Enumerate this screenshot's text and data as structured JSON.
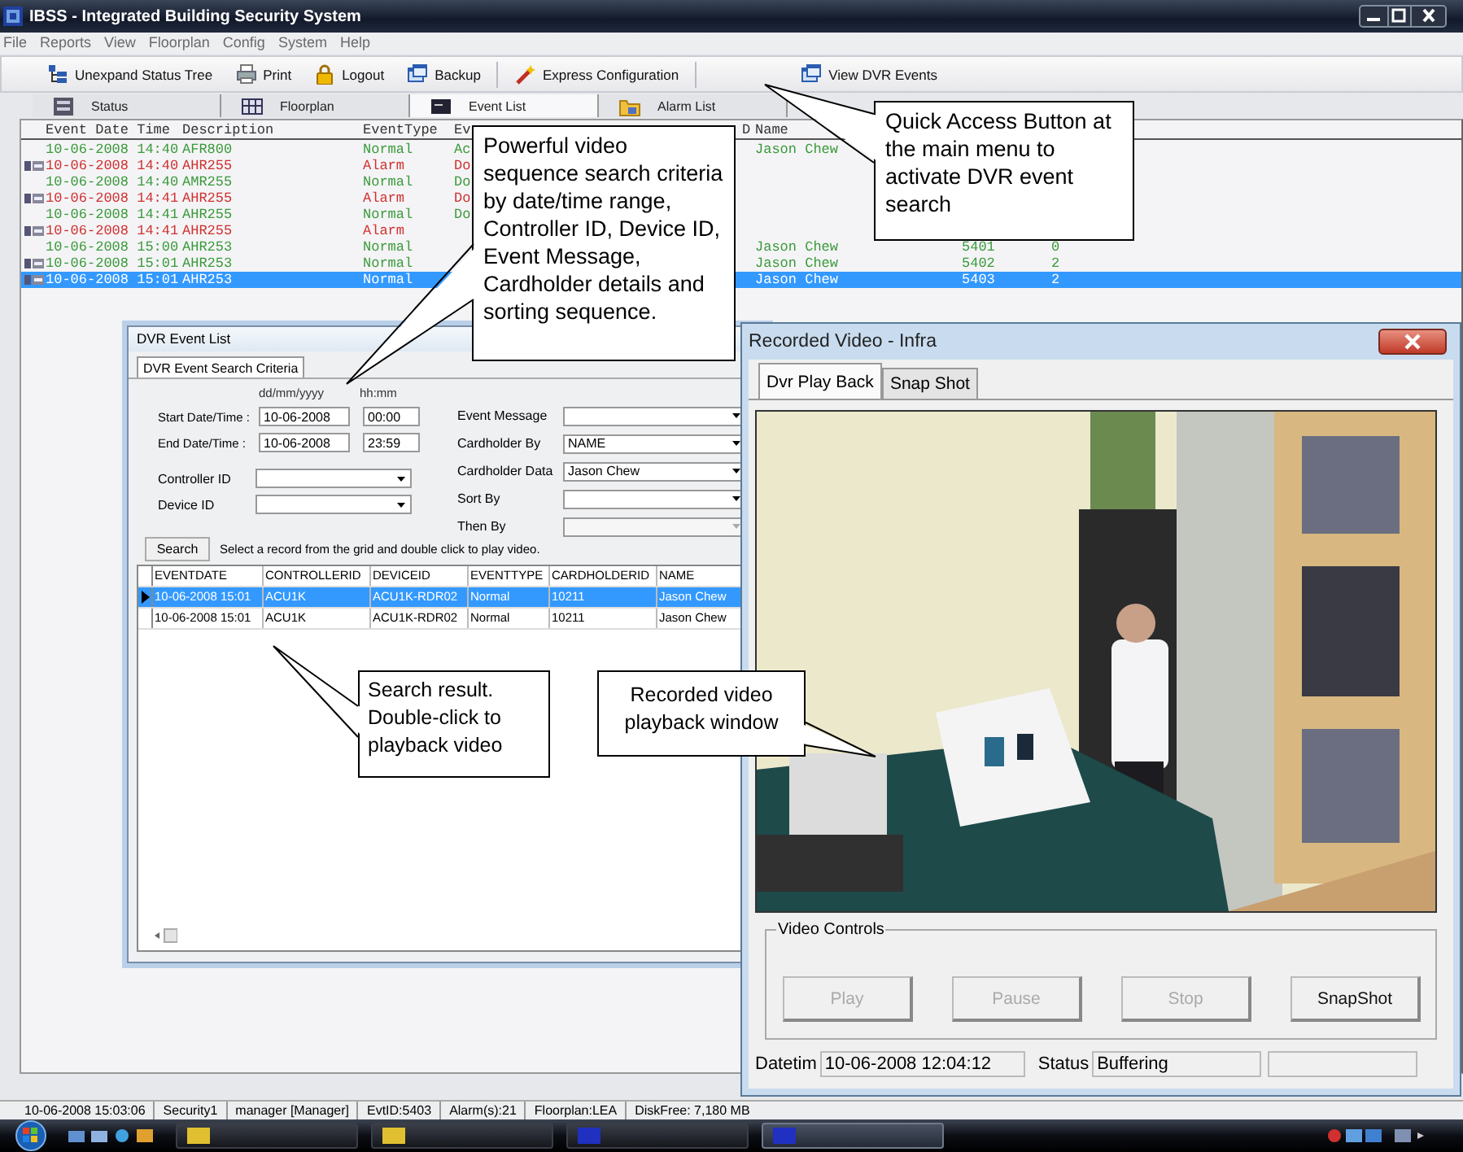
{
  "window": {
    "title": "IBSS - Integrated Building Security System"
  },
  "menu": [
    "File",
    "Reports",
    "View",
    "Floorplan",
    "Config",
    "System",
    "Help"
  ],
  "toolbar": [
    {
      "label": "Unexpand Status Tree"
    },
    {
      "label": "Print"
    },
    {
      "label": "Logout"
    },
    {
      "label": "Backup"
    },
    {
      "label": "Express Configuration"
    },
    {
      "label": "View DVR Events"
    }
  ],
  "tabs": [
    {
      "label": "Status",
      "selected": false
    },
    {
      "label": "Floorplan",
      "selected": false
    },
    {
      "label": "Event List",
      "selected": true
    },
    {
      "label": "Alarm List",
      "selected": false
    }
  ],
  "event_list": {
    "columns": [
      "Event Date Time",
      "Description",
      "EventType",
      "Ev",
      "D",
      "Name"
    ],
    "rows": [
      {
        "kind": "normal",
        "marked": false,
        "selected": false,
        "date_time": "10-06-2008 14:40",
        "description": "AFR800",
        "event_type": "Normal",
        "column_4": "Ac",
        "name": "Jason Chew"
      },
      {
        "kind": "alarm",
        "marked": true,
        "selected": false,
        "date_time": "10-06-2008 14:40",
        "description": "AHR255",
        "event_type": "Alarm",
        "column_4": "Do"
      },
      {
        "kind": "normal",
        "marked": false,
        "selected": false,
        "date_time": "10-06-2008 14:40",
        "description": "AMR255",
        "event_type": "Normal",
        "column_4": "Do"
      },
      {
        "kind": "alarm",
        "marked": true,
        "selected": false,
        "date_time": "10-06-2008 14:41",
        "description": "AHR255",
        "event_type": "Alarm",
        "column_4": "Do"
      },
      {
        "kind": "normal",
        "marked": false,
        "selected": false,
        "date_time": "10-06-2008 14:41",
        "description": "AHR255",
        "event_type": "Normal",
        "column_4": "Do"
      },
      {
        "kind": "alarm",
        "marked": true,
        "selected": false,
        "date_time": "10-06-2008 14:41",
        "description": "AHR255",
        "event_type": "Alarm"
      },
      {
        "kind": "normal",
        "marked": false,
        "selected": false,
        "date_time": "10-06-2008 15:00",
        "description": "AHR253",
        "event_type": "Normal",
        "name": "Jason Chew",
        "column_7": "5401",
        "column_8": "0"
      },
      {
        "kind": "normal",
        "marked": true,
        "selected": false,
        "date_time": "10-06-2008 15:01",
        "description": "AHR253",
        "event_type": "Normal",
        "name": "Jason Chew",
        "column_7": "5402",
        "column_8": "2"
      },
      {
        "kind": "normal",
        "marked": true,
        "selected": true,
        "date_time": "10-06-2008 15:01",
        "description": "AHR253",
        "event_type": "Normal",
        "name": "Jason Chew",
        "column_7": "5403",
        "column_8": "2"
      }
    ]
  },
  "dvr_window": {
    "title": "DVR Event List",
    "tabs": [
      {
        "label": "DVR Event Search Criteria",
        "selected": true
      }
    ],
    "date_hint": "dd/mm/yyyy",
    "time_hint": "hh:mm",
    "ranges": [
      {
        "label": "Start Date/Time :",
        "date": "10-06-2008",
        "time": "00:00"
      },
      {
        "label": "End Date/Time :",
        "date": "10-06-2008",
        "time": "23:59"
      }
    ],
    "left_fields": [
      {
        "label": "Controller ID"
      },
      {
        "label": "Device ID"
      }
    ],
    "right_fields": [
      {
        "label": "Event Message",
        "disabled": false
      },
      {
        "label": "Cardholder By",
        "value": "NAME",
        "disabled": false
      },
      {
        "label": "Cardholder Data",
        "value": "Jason Chew",
        "disabled": false
      },
      {
        "label": "Sort By",
        "disabled": false
      },
      {
        "label": "Then By",
        "disabled": true
      }
    ],
    "search_button": "Search",
    "hint": "Select a record from the grid and double click to play video.",
    "grid": {
      "columns": [
        "EVENTDATE",
        "CONTROLLERID",
        "DEVICEID",
        "EVENTTYPE",
        "CARDHOLDERID",
        "NAME"
      ],
      "rows": [
        {
          "selected": true,
          "cells": [
            "10-06-2008 15:01",
            "ACU1K",
            "ACU1K-RDR02",
            "Normal",
            "10211",
            "Jason Chew"
          ]
        },
        {
          "selected": false,
          "cells": [
            "10-06-2008 15:01",
            "ACU1K",
            "ACU1K-RDR02",
            "Normal",
            "10211",
            "Jason Chew"
          ]
        }
      ]
    }
  },
  "video_window": {
    "title": "Recorded Video - Infra",
    "tabs": [
      {
        "label": "Dvr Play Back",
        "selected": true
      },
      {
        "label": "Snap Shot",
        "selected": false
      }
    ],
    "controls_title": "Video Controls",
    "buttons": [
      {
        "label": "Play",
        "disabled": true
      },
      {
        "label": "Pause",
        "disabled": true
      },
      {
        "label": "Stop",
        "disabled": true
      },
      {
        "label": "SnapShot",
        "disabled": false
      }
    ],
    "datetime_label": "Datetim",
    "datetime": "10-06-2008 12:04:12",
    "status_label": "Status",
    "status": "Buffering"
  },
  "status_bar": [
    "10-06-2008 15:03:06",
    "Security1",
    "manager [Manager]",
    "EvtID:5403",
    "Alarm(s):21",
    "Floorplan:LEA",
    "DiskFree: 7,180 MB"
  ],
  "callouts": [
    {
      "text": "Powerful video sequence search criteria by date/time range, Controller ID, Device ID, Event Message, Cardholder details and sorting sequence."
    },
    {
      "text": "Quick Access Button at the main menu to activate DVR event search"
    },
    {
      "text": "Search result. Double-click to playback video"
    },
    {
      "text": "Recorded video playback window"
    }
  ]
}
